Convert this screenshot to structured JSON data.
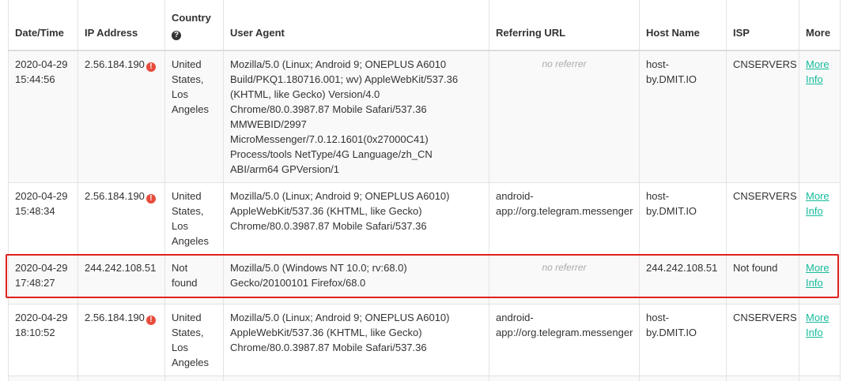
{
  "headers": {
    "datetime": "Date/Time",
    "ip": "IP Address",
    "country": "Country",
    "useragent": "User Agent",
    "referrer": "Referring URL",
    "host": "Host Name",
    "isp": "ISP",
    "more": "More"
  },
  "icons": {
    "country_help": "question-circle-icon",
    "ip_warning": "exclamation-circle-icon"
  },
  "highlight_color": "#e0211f",
  "link_color": "#18bc9c",
  "rows": [
    {
      "date": "2020-04-29",
      "time": "15:44:56",
      "ip": "2.56.184.190",
      "warn": true,
      "country": [
        "United",
        "States,",
        "Los",
        "Angeles"
      ],
      "ua": [
        "Mozilla/5.0 (Linux; Android 9; ONEPLUS A6010",
        "Build/PKQ1.180716.001; wv) AppleWebKit/537.36",
        "(KHTML, like Gecko) Version/4.0",
        "Chrome/80.0.3987.87 Mobile Safari/537.36",
        "MMWEBID/2997",
        "MicroMessenger/7.0.12.1601(0x27000C41)",
        "Process/tools NetType/4G Language/zh_CN",
        "ABI/arm64 GPVersion/1"
      ],
      "referrer": "",
      "no_referrer": "no referrer",
      "host": [
        "host-",
        "by.DMIT.IO"
      ],
      "isp": "CNSERVERS",
      "more": [
        "More",
        "Info"
      ]
    },
    {
      "date": "2020-04-29",
      "time": "15:48:34",
      "ip": "2.56.184.190",
      "warn": true,
      "country": [
        "United",
        "States,",
        "Los",
        "Angeles"
      ],
      "ua": [
        "Mozilla/5.0 (Linux; Android 9; ONEPLUS A6010)",
        "AppleWebKit/537.36 (KHTML, like Gecko)",
        "Chrome/80.0.3987.87 Mobile Safari/537.36"
      ],
      "referrer": [
        "android-",
        "app://org.telegram.messenger"
      ],
      "host": [
        "host-",
        "by.DMIT.IO"
      ],
      "isp": "CNSERVERS",
      "more": [
        "More",
        "Info"
      ]
    },
    {
      "date": "2020-04-29",
      "time": "17:48:27",
      "ip": "244.242.108.51",
      "warn": false,
      "country": [
        "Not",
        "found"
      ],
      "ua": [
        "Mozilla/5.0 (Windows NT 10.0; rv:68.0)",
        "Gecko/20100101 Firefox/68.0"
      ],
      "referrer": "",
      "no_referrer": "no referrer",
      "host": [
        "244.242.108.51"
      ],
      "isp": "Not found",
      "more": [
        "More",
        "Info"
      ]
    },
    {
      "date": "2020-04-29",
      "time": "18:10:52",
      "ip": "2.56.184.190",
      "warn": true,
      "country": [
        "United",
        "States,",
        "Los",
        "Angeles"
      ],
      "ua": [
        "Mozilla/5.0 (Linux; Android 9; ONEPLUS A6010)",
        "AppleWebKit/537.36 (KHTML, like Gecko)",
        "Chrome/80.0.3987.87 Mobile Safari/537.36"
      ],
      "referrer": [
        "android-",
        "app://org.telegram.messenger"
      ],
      "host": [
        "host-",
        "by.DMIT.IO"
      ],
      "isp": "CNSERVERS",
      "more": [
        "More",
        "Info"
      ]
    }
  ]
}
